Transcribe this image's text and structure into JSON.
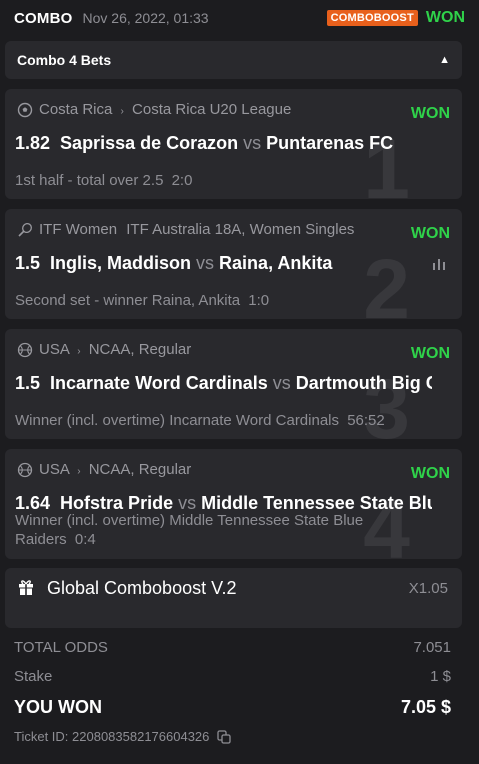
{
  "header": {
    "title": "COMBO",
    "date": "Nov 26, 2022, 01:33",
    "boost_badge": "COMBOBOOST",
    "status": "WON"
  },
  "combo_bar": {
    "title": "Combo 4 Bets",
    "toggle_icon": "caret-up-icon"
  },
  "bets": [
    {
      "index": "1",
      "sport_icon": "soccer-ball-icon",
      "country": "Costa Rica",
      "league": "Costa Rica U20 League",
      "status": "WON",
      "odds": "1.82",
      "team1": "Saprissa de Corazon",
      "vs": "vs",
      "team2": "Puntarenas FC",
      "market": "1st half - total over 2.5",
      "score": "2:0"
    },
    {
      "index": "2",
      "sport_icon": "tennis-racket-icon",
      "country": "ITF Women",
      "league": "ITF Australia 18A, Women Singles",
      "status": "WON",
      "odds": "1.5",
      "team1": "Inglis, Maddison",
      "vs": "vs",
      "team2": "Raina, Ankita",
      "market": "Second set - winner Raina, Ankita",
      "score": "1:0",
      "stats_icon": "bar-chart-icon"
    },
    {
      "index": "3",
      "sport_icon": "basketball-icon",
      "country": "USA",
      "league": "NCAA, Regular",
      "status": "WON",
      "odds": "1.5",
      "team1": "Incarnate Word Cardinals",
      "vs": "vs",
      "team2": "Dartmouth Big Green",
      "market": "Winner (incl. overtime) Incarnate Word Cardinals",
      "score": "56:52"
    },
    {
      "index": "4",
      "sport_icon": "basketball-icon",
      "country": "USA",
      "league": "NCAA, Regular",
      "status": "WON",
      "odds": "1.64",
      "team1": "Hofstra Pride",
      "vs": "vs",
      "team2": "Middle Tennessee State Blue Raiders",
      "market": "Winner (incl. overtime) Middle Tennessee State Blue Raiders",
      "score": "0:4"
    }
  ],
  "global_boost": {
    "icon": "gift-icon",
    "title": "Global Comboboost V.2",
    "multiplier": "X1.05"
  },
  "summary": {
    "total_odds_label": "TOTAL ODDS",
    "total_odds_value": "7.051",
    "stake_label": "Stake",
    "stake_value": "1 $",
    "won_label": "YOU WON",
    "won_value": "7.05 $"
  },
  "ticket": {
    "label": "Ticket ID: 2208083582176604326",
    "copy_icon": "copy-icon"
  },
  "colors": {
    "background": "#1c1c1f",
    "card": "#29292d",
    "won_green": "#2fd24a",
    "boost_orange": "#e8601c",
    "muted": "#8e8e94"
  }
}
